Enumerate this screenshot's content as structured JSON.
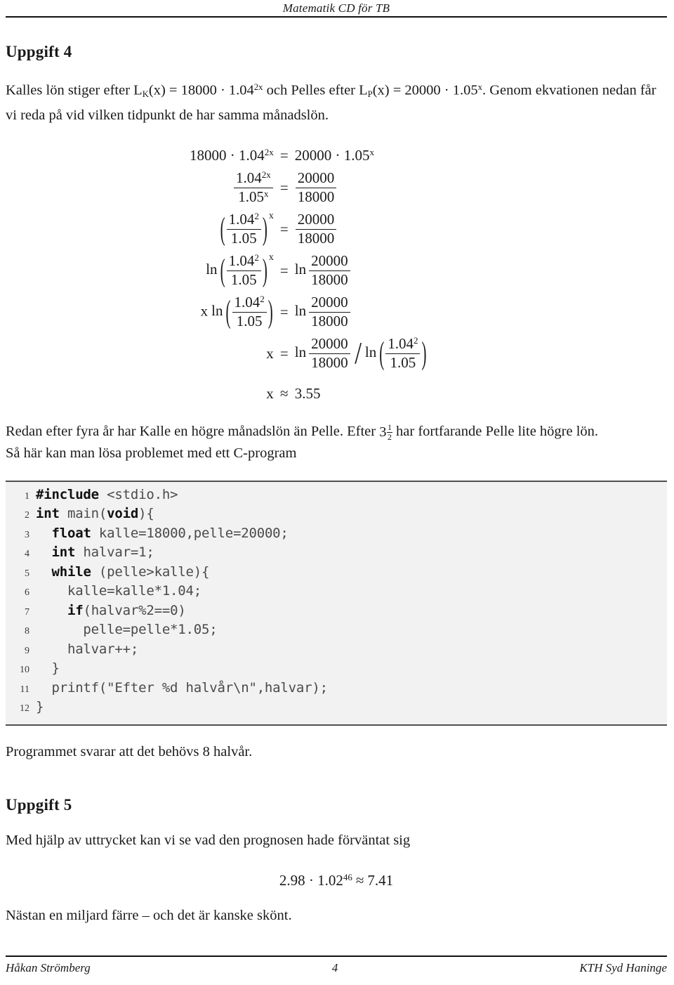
{
  "header": {
    "running_title": "Matematik CD för TB"
  },
  "sections": {
    "uppgift4": {
      "heading": "Uppgift 4",
      "intro": {
        "part1": "Kalles lön stiger efter L",
        "sub1": "K",
        "part2": "(x) = 18000 · 1.04",
        "sup1": "2x",
        "part3": " och Pelles efter L",
        "sub2": "P",
        "part4": "(x) = 20000 · 1.05",
        "sup2": "x",
        "part5": ". Genom ekvationen nedan får vi reda på vid vilken tidpunkt de har samma månadslön."
      },
      "after_text": {
        "line1_a": "Redan efter fyra år har Kalle en högre månadslön än Pelle. Efter ",
        "mixed_whole": "3",
        "mixed_num": "1",
        "mixed_den": "2",
        "line1_b": " har fortfarande Pelle lite högre lön.",
        "line2": "Så här kan man lösa problemet med ett C-program"
      },
      "result_text": "Programmet svarar att det behövs 8 halvår."
    },
    "uppgift5": {
      "heading": "Uppgift 5",
      "intro": "Med hjälp av uttrycket kan vi se vad den prognosen hade förväntat sig",
      "formula": {
        "base1": "2.98 · 1.02",
        "exp1": "46",
        "rel": "≈",
        "value": "7.41"
      },
      "closing": "Nästan en miljard färre – och det är kanske skönt."
    }
  },
  "equations": {
    "rows": [
      {
        "id": "eq1",
        "lhs_a": "18000 · 1.04",
        "lhs_sup": "2x",
        "rel": "=",
        "rhs_a": "20000 · 1.05",
        "rhs_sup": "x"
      },
      {
        "id": "eq2",
        "lhs_num_a": "1.04",
        "lhs_num_sup": "2x",
        "lhs_den_a": "1.05",
        "lhs_den_sup": "x",
        "rel": "=",
        "rhs_num": "20000",
        "rhs_den": "18000"
      },
      {
        "id": "eq3",
        "lhs_num_a": "1.04",
        "lhs_num_sup": "2",
        "lhs_den": "1.05",
        "lhs_pow": "x",
        "rel": "=",
        "rhs_num": "20000",
        "rhs_den": "18000"
      },
      {
        "id": "eq4",
        "ln": "ln",
        "lhs_num_a": "1.04",
        "lhs_num_sup": "2",
        "lhs_den": "1.05",
        "lhs_pow": "x",
        "rel": "=",
        "rhs_ln": "ln",
        "rhs_num": "20000",
        "rhs_den": "18000"
      },
      {
        "id": "eq5",
        "xvar": "x",
        "ln": "ln",
        "lhs_num_a": "1.04",
        "lhs_num_sup": "2",
        "lhs_den": "1.05",
        "rel": "=",
        "rhs_ln": "ln",
        "rhs_num": "20000",
        "rhs_den": "18000"
      },
      {
        "id": "eq6",
        "lhs": "x",
        "rel": "=",
        "rhs_ln1": "ln",
        "rhs_num": "20000",
        "rhs_den": "18000",
        "slash": "/",
        "rhs_ln2": "ln",
        "rhs2_num_a": "1.04",
        "rhs2_num_sup": "2",
        "rhs2_den": "1.05"
      },
      {
        "id": "eq7",
        "lhs": "x",
        "rel": "≈",
        "rhs": "3.55"
      }
    ]
  },
  "code_listing": {
    "lines": [
      {
        "no": "1",
        "segments": [
          {
            "t": "#include",
            "kw": true
          },
          {
            "t": " <stdio.h>",
            "kw": false
          }
        ]
      },
      {
        "no": "2",
        "segments": [
          {
            "t": "int",
            "kw": true
          },
          {
            "t": " main(",
            "kw": false
          },
          {
            "t": "void",
            "kw": true
          },
          {
            "t": "){",
            "kw": false
          }
        ]
      },
      {
        "no": "3",
        "segments": [
          {
            "t": "  ",
            "kw": false
          },
          {
            "t": "float",
            "kw": true
          },
          {
            "t": " kalle=18000,pelle=20000;",
            "kw": false
          }
        ]
      },
      {
        "no": "4",
        "segments": [
          {
            "t": "  ",
            "kw": false
          },
          {
            "t": "int",
            "kw": true
          },
          {
            "t": " halvar=1;",
            "kw": false
          }
        ]
      },
      {
        "no": "5",
        "segments": [
          {
            "t": "  ",
            "kw": false
          },
          {
            "t": "while",
            "kw": true
          },
          {
            "t": " (pelle>kalle){",
            "kw": false
          }
        ]
      },
      {
        "no": "6",
        "segments": [
          {
            "t": "    kalle=kalle*1.04;",
            "kw": false
          }
        ]
      },
      {
        "no": "7",
        "segments": [
          {
            "t": "    ",
            "kw": false
          },
          {
            "t": "if",
            "kw": true
          },
          {
            "t": "(halvar%2==0)",
            "kw": false
          }
        ]
      },
      {
        "no": "8",
        "segments": [
          {
            "t": "      pelle=pelle*1.05;",
            "kw": false
          }
        ]
      },
      {
        "no": "9",
        "segments": [
          {
            "t": "    halvar++;",
            "kw": false
          }
        ]
      },
      {
        "no": "10",
        "segments": [
          {
            "t": "  }",
            "kw": false
          }
        ]
      },
      {
        "no": "11",
        "segments": [
          {
            "t": "  printf(\"Efter %d halvår\\n\",halvar);",
            "kw": false
          }
        ]
      },
      {
        "no": "12",
        "segments": [
          {
            "t": "}",
            "kw": false
          }
        ]
      }
    ]
  },
  "footer": {
    "left": "Håkan Strömberg",
    "center": "4",
    "right": "KTH Syd Haninge"
  },
  "colors": {
    "text": "#1a1a1a",
    "code_bg": "#f2f2f2",
    "code_rule": "#4f4f4f",
    "code_text": "#4a4a4a",
    "rule": "#111111"
  }
}
